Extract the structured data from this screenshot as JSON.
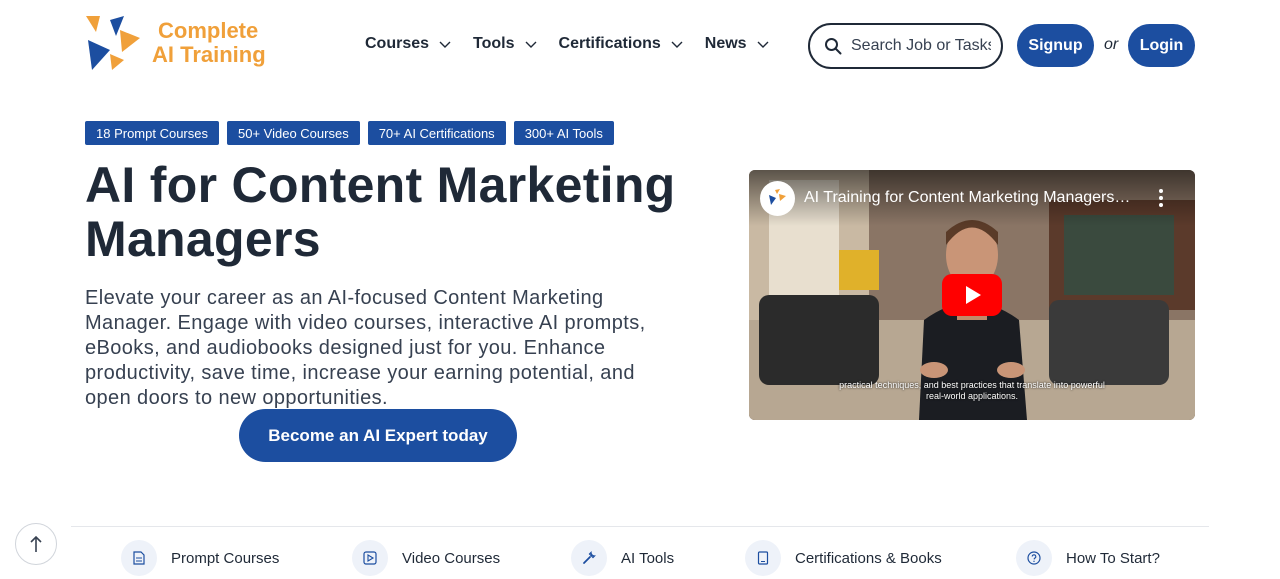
{
  "brand": {
    "name_line1": "Complete",
    "name_line2": "AI Training",
    "colors": {
      "orange": "#f0a03a",
      "blue": "#1c4ea0"
    }
  },
  "nav": {
    "items": [
      {
        "label": "Courses",
        "icon": "chevron-down-icon"
      },
      {
        "label": "Tools",
        "icon": "chevron-down-icon"
      },
      {
        "label": "Certifications",
        "icon": "chevron-down-icon"
      },
      {
        "label": "News",
        "icon": "chevron-down-icon"
      }
    ]
  },
  "search": {
    "placeholder": "Search Job or Tasks",
    "icon": "search-icon"
  },
  "auth": {
    "signup_label": "Signup",
    "or_text": "or",
    "login_label": "Login"
  },
  "badges": [
    "18 Prompt Courses",
    "50+ Video Courses",
    "70+ AI Certifications",
    "300+ AI Tools"
  ],
  "hero": {
    "title": "AI for Content Marketing Managers",
    "description": "Elevate your career as an AI-focused Content Marketing Manager. Engage with video courses, interactive AI prompts, eBooks, and audiobooks designed just for you. Enhance productivity, save time, increase your earning potential, and open doors to new opportunities.",
    "cta_label": "Become an AI Expert today"
  },
  "video": {
    "title": "AI Training for Content Marketing Managers: ...",
    "caption_line1": "practical techniques, and best practices that translate into powerful",
    "caption_line2": "real-world applications.",
    "channel_avatar_text": "Complete AI Training",
    "play_icon": "youtube-play-icon",
    "more_icon": "more-vertical-icon"
  },
  "bottom_nav": {
    "scroll_top_icon": "arrow-up-icon",
    "items": [
      {
        "label": "Prompt Courses",
        "icon": "document-icon"
      },
      {
        "label": "Video Courses",
        "icon": "play-square-icon"
      },
      {
        "label": "AI Tools",
        "icon": "wrench-icon"
      },
      {
        "label": "Certifications & Books",
        "icon": "book-icon"
      },
      {
        "label": "How To Start?",
        "icon": "help-circle-icon"
      }
    ]
  }
}
